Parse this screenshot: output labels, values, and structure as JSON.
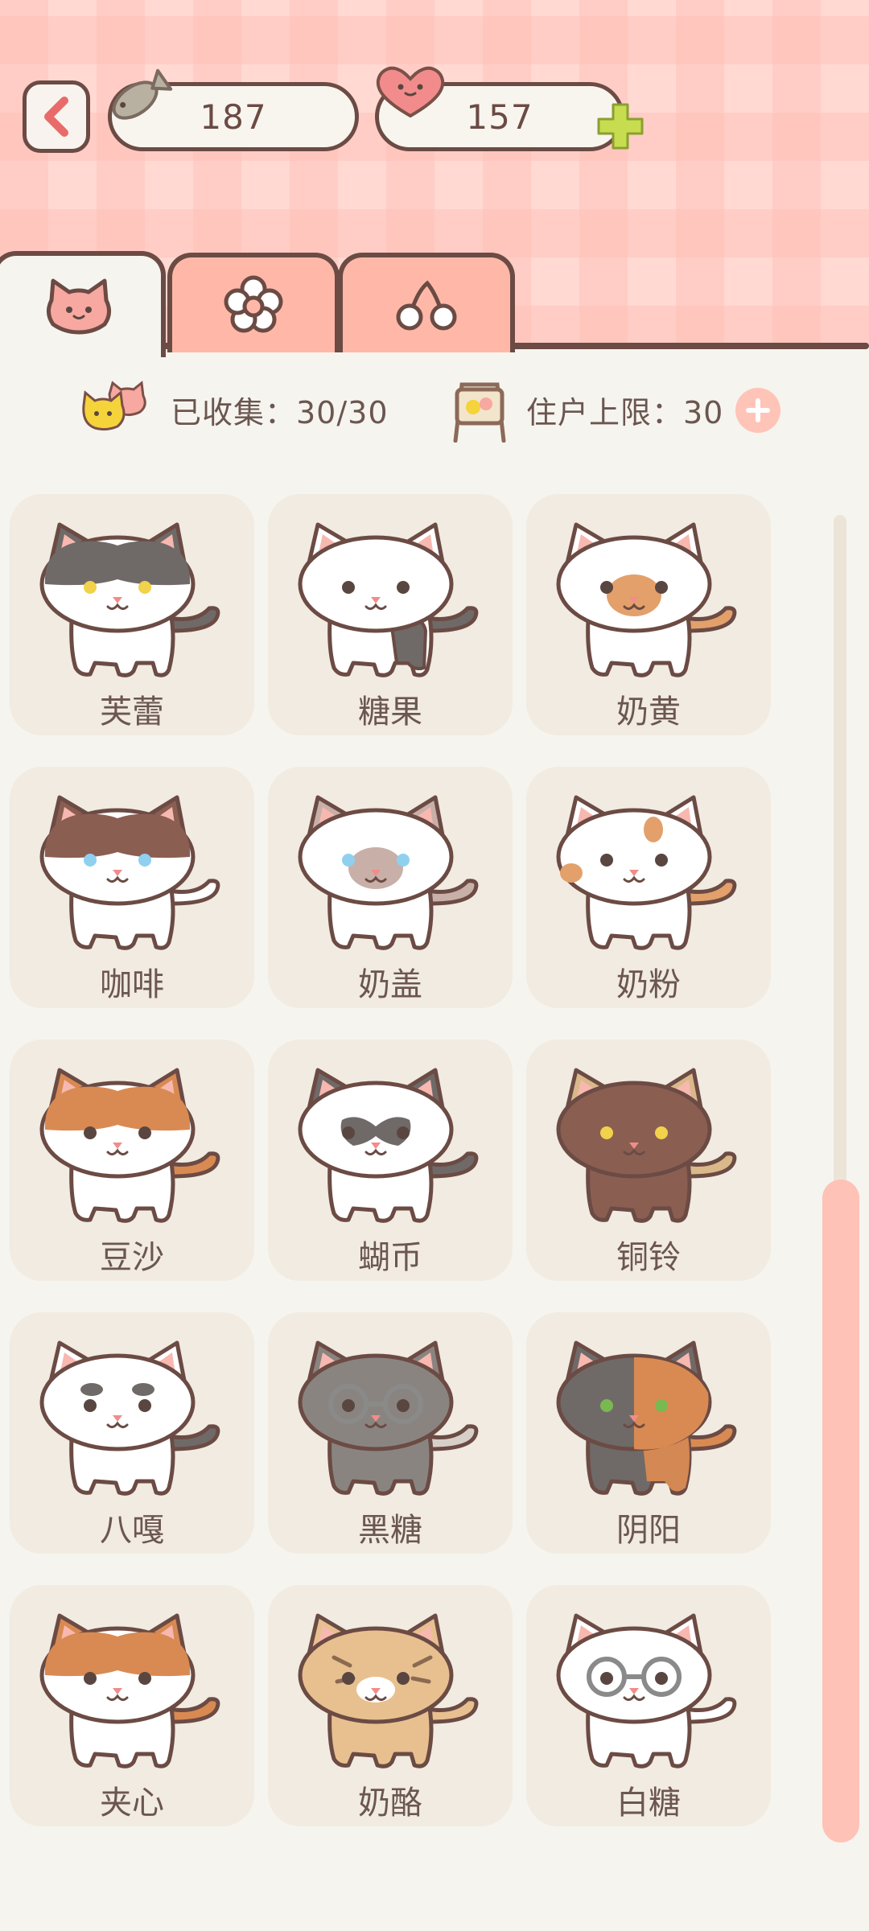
{
  "currency": {
    "fish_count": "187",
    "heart_count": "157"
  },
  "stats": {
    "collected_label": "已收集：30/30",
    "limit_label": "住户上限：30"
  },
  "colors": {
    "accent": "#ffb8a8",
    "outline": "#6b4b44",
    "card_bg": "#f1ebe1",
    "plus_green": "#c8dc50"
  },
  "scroll": {
    "position_fraction": 0.5
  },
  "cats": [
    {
      "name": "芙蕾",
      "body": "#ffffff",
      "patch": "#6f6a68",
      "patch_style": "mask",
      "ears": "#6f6a68",
      "eyes": "#f1d24a",
      "tail": "#6f6a68"
    },
    {
      "name": "糖果",
      "body": "#ffffff",
      "patch": "#6f6a68",
      "patch_style": "rear",
      "ears": "#ffffff",
      "eyes": "#5a4640",
      "tail": "#6f6a68"
    },
    {
      "name": "奶黄",
      "body": "#ffffff",
      "patch": "#e3a06a",
      "patch_style": "muzzle",
      "ears": "#ffffff",
      "eyes": "#5a4640",
      "tail": "#e3a06a"
    },
    {
      "name": "咖啡",
      "body": "#ffffff",
      "patch": "#8b5e52",
      "patch_style": "mask",
      "ears": "#8b5e52",
      "eyes": "#8fd0f0",
      "tail": "#ffffff"
    },
    {
      "name": "奶盖",
      "body": "#ffffff",
      "patch": "#c8b0a8",
      "patch_style": "muzzle",
      "ears": "#c8b0a8",
      "eyes": "#8fd0f0",
      "tail": "#c8b0a8"
    },
    {
      "name": "奶粉",
      "body": "#ffffff",
      "patch": "#e3a06a",
      "patch_style": "spot",
      "ears": "#ffffff",
      "eyes": "#5a4640",
      "tail": "#e3a06a"
    },
    {
      "name": "豆沙",
      "body": "#ffffff",
      "patch": "#d98a52",
      "patch_style": "mask",
      "ears": "#d98a52",
      "eyes": "#5a4640",
      "tail": "#d98a52"
    },
    {
      "name": "蝴币",
      "body": "#ffffff",
      "patch": "#6f6a68",
      "patch_style": "bow",
      "ears": "#6f6a68",
      "eyes": "#5a4640",
      "tail": "#6f6a68"
    },
    {
      "name": "铜铃",
      "body": "#8b5e52",
      "patch": "#8b5e52",
      "patch_style": "none",
      "ears": "#d9b98a",
      "eyes": "#f1d24a",
      "tail": "#d9b98a"
    },
    {
      "name": "八嘎",
      "body": "#ffffff",
      "patch": "#6f6a68",
      "patch_style": "brows",
      "ears": "#ffffff",
      "eyes": "#5a4640",
      "tail": "#6f6a68"
    },
    {
      "name": "黑糖",
      "body": "#8a8480",
      "patch": "#8a8480",
      "patch_style": "glasses",
      "ears": "#8a8480",
      "eyes": "#5a4640",
      "tail": "#d8d0c8"
    },
    {
      "name": "阴阳",
      "body": "#6f6a68",
      "patch": "#d98a52",
      "patch_style": "half",
      "ears": "#6f6a68",
      "eyes": "#7ab850",
      "tail": "#d98a52"
    },
    {
      "name": "夹心",
      "body": "#ffffff",
      "patch": "#d98a52",
      "patch_style": "mask",
      "ears": "#d98a52",
      "eyes": "#5a4640",
      "tail": "#d98a52"
    },
    {
      "name": "奶酪",
      "body": "#e8c090",
      "patch": "#e8c090",
      "patch_style": "lynx",
      "ears": "#e8c090",
      "eyes": "#5a4640",
      "tail": "#e8c090"
    },
    {
      "name": "白糖",
      "body": "#ffffff",
      "patch": "#ffffff",
      "patch_style": "glasses",
      "ears": "#ffffff",
      "eyes": "#5a4640",
      "tail": "#ffffff"
    }
  ]
}
